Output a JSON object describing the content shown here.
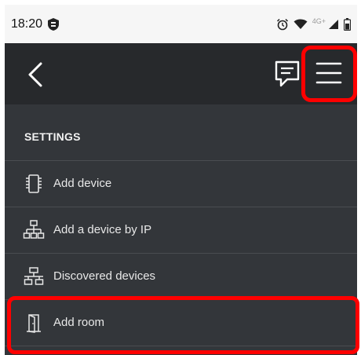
{
  "status_bar": {
    "time": "18:20",
    "network_label": "4G+",
    "icons": [
      "shield-icon",
      "alarm-icon",
      "wifi-icon",
      "signal-icon",
      "battery-icon"
    ]
  },
  "app_bar": {
    "back_icon": "chevron-left-icon",
    "feedback_icon": "chat-icon",
    "menu_icon": "hamburger-menu-icon",
    "background": "#27292c"
  },
  "settings": {
    "title": "SETTINGS",
    "items": [
      {
        "label": "Add device",
        "icon": "device-chip-icon"
      },
      {
        "label": "Add a device by IP",
        "icon": "network-tree-icon"
      },
      {
        "label": "Discovered devices",
        "icon": "network-discovery-icon"
      },
      {
        "label": "Add room",
        "icon": "door-icon"
      }
    ]
  },
  "annotations": {
    "highlight_color": "#ff0000",
    "highlighted": [
      "hamburger-menu-button",
      "add-room-item"
    ]
  }
}
